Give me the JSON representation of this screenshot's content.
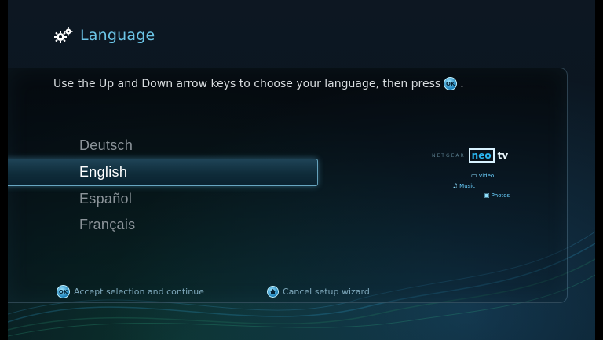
{
  "header": {
    "title": "Language",
    "icon": "gears-icon"
  },
  "instruction": {
    "text": "Use the Up and Down arrow keys to choose your language, then press",
    "button_label": "OK",
    "trailing": "."
  },
  "languages": [
    {
      "label": "Deutsch",
      "selected": false
    },
    {
      "label": "English",
      "selected": true
    },
    {
      "label": "Español",
      "selected": false
    },
    {
      "label": "Français",
      "selected": false
    }
  ],
  "logo": {
    "brand": "NETGEAR",
    "product_neo": "neo",
    "product_tv": "tv",
    "media": [
      "Video",
      "Music",
      "Photos"
    ]
  },
  "footer": {
    "accept_button": "OK",
    "accept_label": "Accept selection and continue",
    "cancel_label": "Cancel setup wizard"
  },
  "colors": {
    "accent": "#6cc6e8",
    "selection_border": "#82c8e6",
    "background": "#0a1620"
  }
}
